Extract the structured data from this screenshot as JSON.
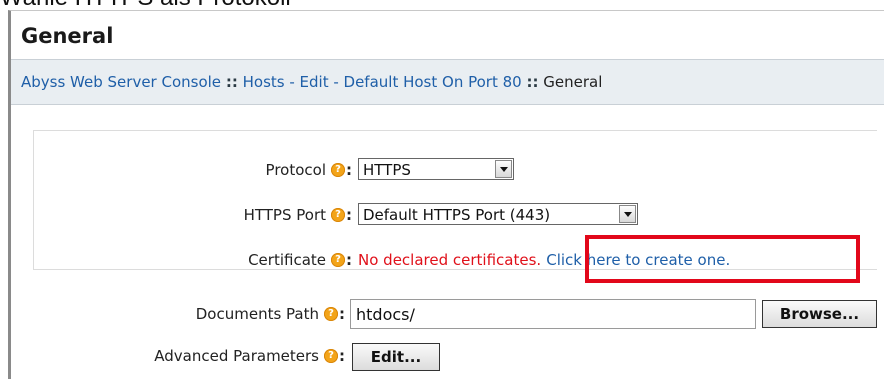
{
  "caption": "Wähle HTTPS als Protokoll",
  "panel": {
    "title": "General"
  },
  "breadcrumb": {
    "items": [
      {
        "label": "Abyss Web Server Console"
      },
      {
        "label": "Hosts - Edit - Default Host On Port 80"
      }
    ],
    "separator": "::",
    "current": "General"
  },
  "form": {
    "protocol": {
      "label": "Protocol",
      "value": "HTTPS"
    },
    "https_port": {
      "label": "HTTPS Port",
      "value": "Default HTTPS Port (443)"
    },
    "certificate": {
      "label": "Certificate",
      "error": "No declared certificates.",
      "link": "Click here to create one."
    },
    "documents_path": {
      "label": "Documents Path",
      "value": "htdocs/",
      "button": "Browse..."
    },
    "advanced_parameters": {
      "label": "Advanced Parameters",
      "button": "Edit..."
    }
  },
  "icons": {
    "help": "help-icon"
  },
  "colors": {
    "error": "#e0101a",
    "link": "#1f5fa8",
    "highlight": "#e2071a",
    "help_icon": "#f3a419"
  }
}
